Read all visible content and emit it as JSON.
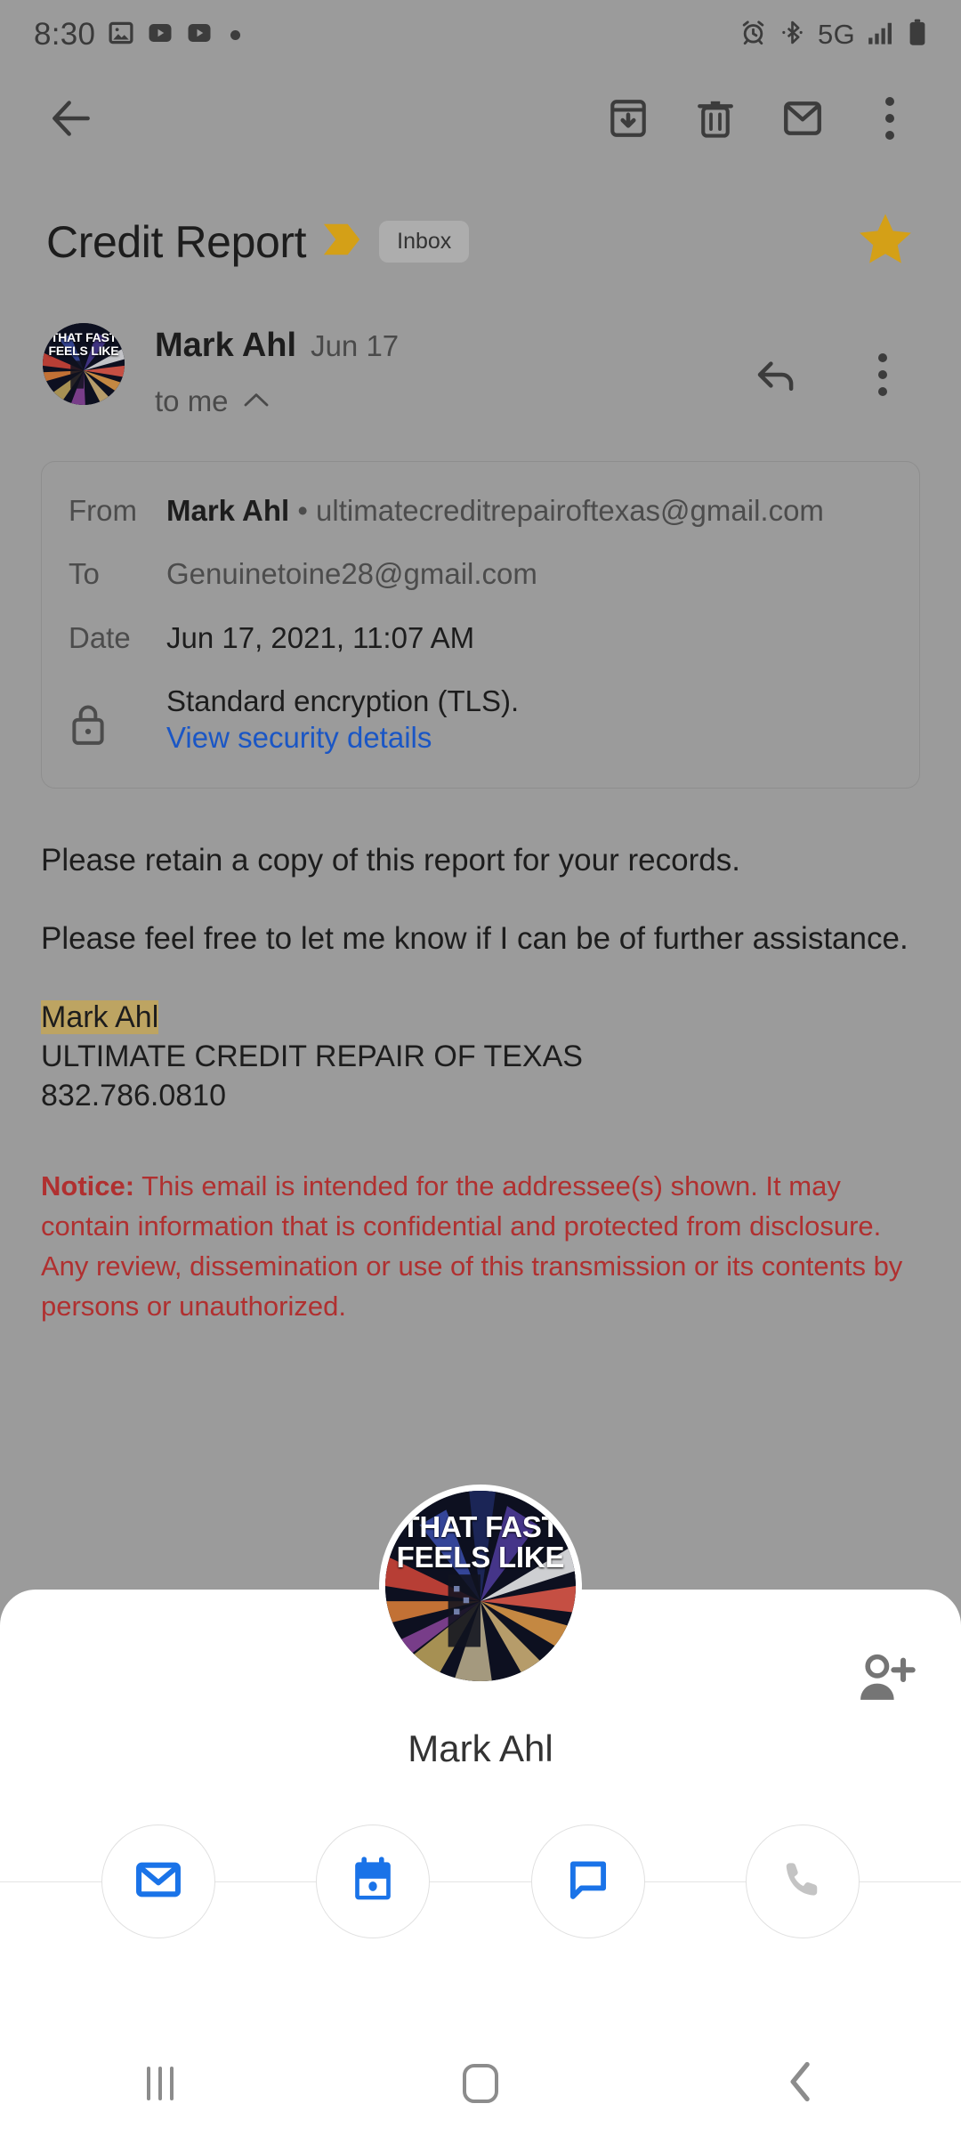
{
  "status_bar": {
    "time": "8:30",
    "left_icons": [
      "photo-icon",
      "youtube-icon",
      "youtube-icon",
      "dot-indicator"
    ],
    "right_icons": [
      "alarm-icon",
      "bluetooth-icon",
      "signal-bars-icon",
      "battery-icon"
    ],
    "network": "5G"
  },
  "app_bar": {
    "back": "back-arrow-icon",
    "archive": "archive-icon",
    "delete": "trash-icon",
    "mark_unread": "mail-icon",
    "more": "more-vertical-icon"
  },
  "email": {
    "subject": "Credit Report",
    "label": "Inbox",
    "starred": true,
    "important": true,
    "sender_name": "Mark Ahl",
    "sender_date": "Jun 17",
    "recipient_summary": "to me",
    "details": {
      "from_label": "From",
      "from_name": "Mark Ahl",
      "from_separator": "•",
      "from_email": "ultimatecreditrepairoftexas@gmail.com",
      "to_label": "To",
      "to_value": "Genuinetoine28@gmail.com",
      "date_label": "Date",
      "date_value": "Jun 17, 2021, 11:07 AM",
      "encryption": "Standard encryption (TLS).",
      "security_link": "View security details"
    },
    "body": {
      "paragraph_1": "Please retain a copy of this report for your records.",
      "paragraph_2": "Please feel free to let me know if I can be of further assistance.",
      "signature_name": "Mark Ahl",
      "signature_company": "ULTIMATE CREDIT REPAIR OF TEXAS",
      "signature_phone": "832.786.0810",
      "notice_label": "Notice:",
      "notice_text": "This email is intended for the addressee(s) shown. It may contain information that is confidential and protected from disclosure.   Any review, dissemination or use  of  this  transmission  or its  contents by persons  or  unauthorized."
    }
  },
  "contact_sheet": {
    "name": "Mark Ahl",
    "add_contact_icon": "person-add-icon",
    "avatar_text_line_1": "THAT FAST",
    "avatar_text_line_2": "FEELS LIKE",
    "actions": [
      {
        "name": "email",
        "icon": "email-icon",
        "enabled": true
      },
      {
        "name": "calendar",
        "icon": "calendar-icon",
        "enabled": true
      },
      {
        "name": "chat",
        "icon": "chat-icon",
        "enabled": true
      },
      {
        "name": "call",
        "icon": "phone-icon",
        "enabled": false
      }
    ]
  },
  "nav_bar": {
    "recents": "recents-icon",
    "home": "home-icon",
    "back": "back-icon"
  },
  "colors": {
    "accent_blue": "#1a73e8",
    "link_blue": "#1a56c5",
    "star_gold": "#d4a017",
    "important_gold": "#d4a017",
    "notice_red": "#b03030",
    "highlight_tan": "#bda462",
    "scrim": "#9b9b9b"
  }
}
